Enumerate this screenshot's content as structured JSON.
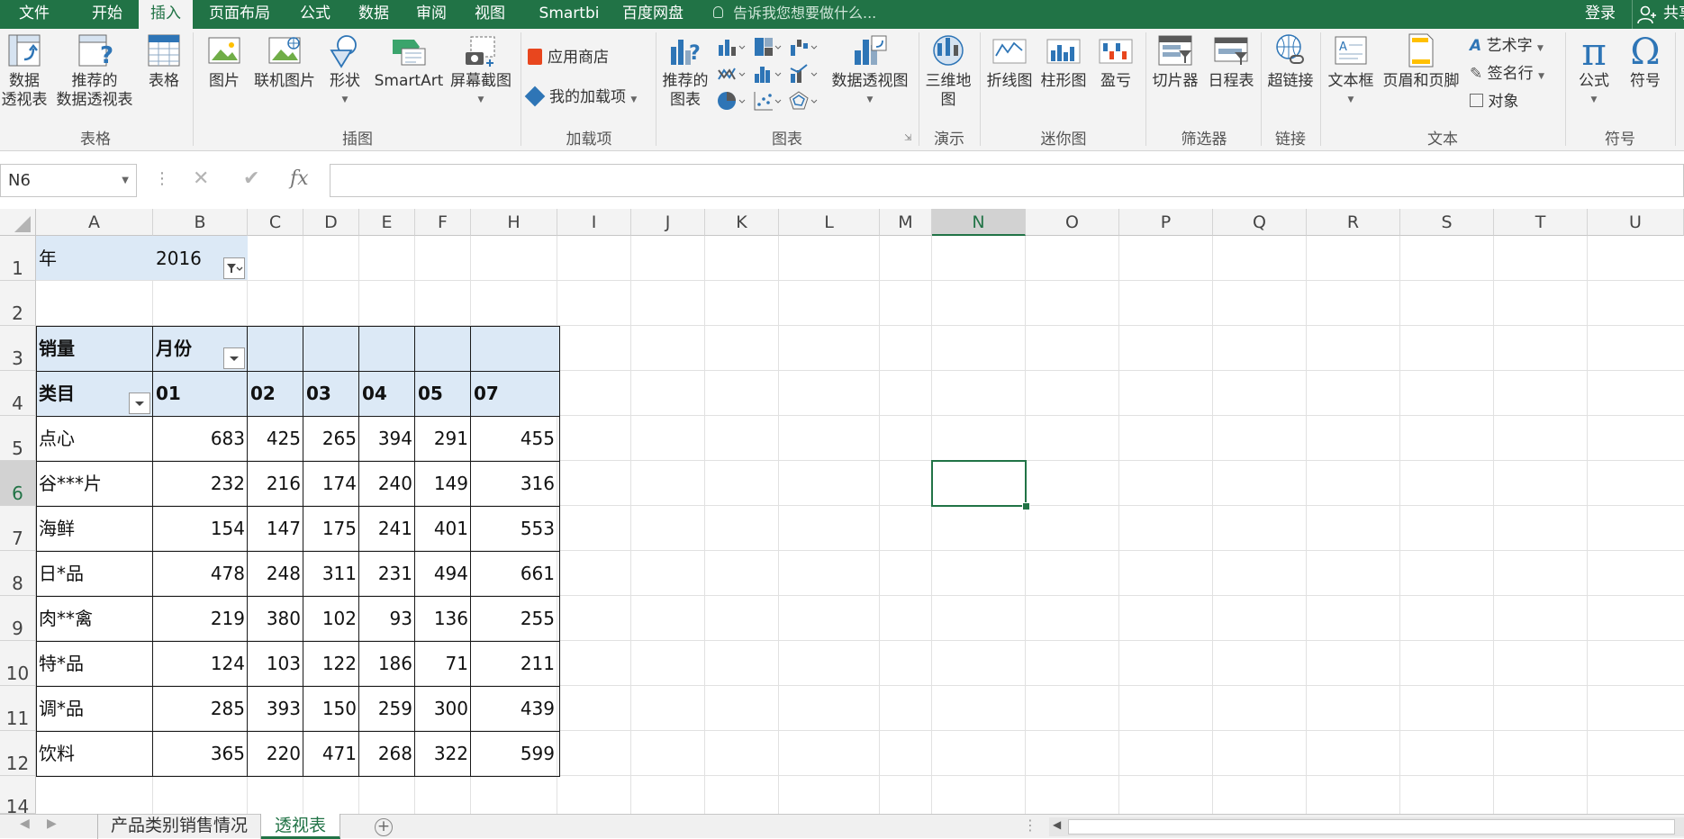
{
  "menu": {
    "tabs": [
      "文件",
      "开始",
      "插入",
      "页面布局",
      "公式",
      "数据",
      "审阅",
      "视图",
      "Smartbi",
      "百度网盘"
    ],
    "active_tab": "插入",
    "tell_me": "告诉我您想要做什么...",
    "login": "登录",
    "share": "共享"
  },
  "ribbon": {
    "pivot_table": "数据\n透视表",
    "recommended_pivot": "推荐的\n数据透视表",
    "table": "表格",
    "group_tables": "表格",
    "picture": "图片",
    "online_picture": "联机图片",
    "shapes": "形状",
    "smartart": "SmartArt",
    "screenshot": "屏幕截图",
    "group_illustrations": "插图",
    "store": "应用商店",
    "my_addins": "我的加载项",
    "group_addins": "加载项",
    "recommended_charts": "推荐的\n图表",
    "pivot_chart": "数据透视图",
    "group_charts": "图表",
    "map_3d": "三维地\n图",
    "group_tours": "演示",
    "line": "折线图",
    "column": "柱形图",
    "win_loss": "盈亏",
    "group_sparklines": "迷你图",
    "slicer": "切片器",
    "timeline": "日程表",
    "group_filters": "筛选器",
    "hyperlink": "超链接",
    "group_links": "链接",
    "textbox": "文本框",
    "header_footer": "页眉和页脚",
    "wordart": "艺术字",
    "signature": "签名行",
    "object": "对象",
    "group_text": "文本",
    "equation": "公式",
    "symbol": "符号",
    "group_symbols": "符号"
  },
  "formula_bar": {
    "name_box": "N6",
    "cancel": "✕",
    "enter": "✔",
    "fx": "fx",
    "value": ""
  },
  "columns": [
    "A",
    "B",
    "C",
    "D",
    "E",
    "F",
    "H",
    "I",
    "J",
    "K",
    "L",
    "M",
    "N",
    "O",
    "P",
    "Q",
    "R",
    "S",
    "T",
    "U"
  ],
  "rows": [
    "1",
    "2",
    "3",
    "4",
    "5",
    "6",
    "7",
    "8",
    "9",
    "10",
    "11",
    "12",
    "14"
  ],
  "selected_cell": "N6",
  "pivot": {
    "filter_label": "年",
    "filter_value": "2016",
    "value_label": "销量",
    "column_field": "月份",
    "row_field": "类目",
    "months": [
      "01",
      "02",
      "03",
      "04",
      "05",
      "07"
    ],
    "items": [
      {
        "name": "点心",
        "values": [
          "683",
          "425",
          "265",
          "394",
          "291",
          "455"
        ]
      },
      {
        "name": "谷***片",
        "values": [
          "232",
          "216",
          "174",
          "240",
          "149",
          "316"
        ]
      },
      {
        "name": "海鲜",
        "values": [
          "154",
          "147",
          "175",
          "241",
          "401",
          "553"
        ]
      },
      {
        "name": "日*品",
        "values": [
          "478",
          "248",
          "311",
          "231",
          "494",
          "661"
        ]
      },
      {
        "name": "肉**禽",
        "values": [
          "219",
          "380",
          "102",
          "93",
          "136",
          "255"
        ]
      },
      {
        "name": "特*品",
        "values": [
          "124",
          "103",
          "122",
          "186",
          "71",
          "211"
        ]
      },
      {
        "name": "调*品",
        "values": [
          "285",
          "393",
          "150",
          "259",
          "300",
          "439"
        ]
      },
      {
        "name": "饮料",
        "values": [
          "365",
          "220",
          "471",
          "268",
          "322",
          "599"
        ]
      }
    ]
  },
  "sheet_tabs": {
    "tabs": [
      "产品类别销售情况",
      "透视表"
    ],
    "active": "透视表"
  },
  "colors": {
    "accent": "#217346",
    "pivot_header": "#dce9f6"
  }
}
